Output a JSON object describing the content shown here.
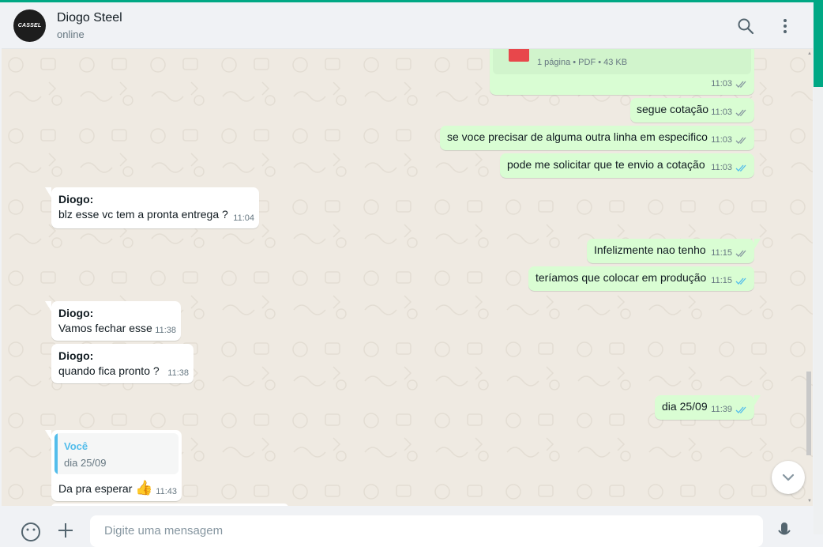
{
  "header": {
    "avatar_text": "CASSEL",
    "contact_name": "Diogo Steel",
    "status": "online"
  },
  "document": {
    "meta": "1 página • PDF • 43 KB",
    "time": "11:03"
  },
  "messages": [
    {
      "text": "segue cotação",
      "time": "11:03"
    },
    {
      "text": "se voce precisar de alguma outra linha em especifico",
      "time": "11:03"
    },
    {
      "text": "pode me solicitar que te envio a cotação",
      "time": "11:03"
    },
    {
      "sender": "Diogo:",
      "text": "blz esse vc tem a pronta entrega ?",
      "time": "11:04"
    },
    {
      "text": "Infelizmente nao tenho",
      "time": "11:15"
    },
    {
      "text": "teríamos que colocar em produção",
      "time": "11:15"
    },
    {
      "sender": "Diogo:",
      "text": "Vamos fechar esse",
      "time": "11:38"
    },
    {
      "sender": "Diogo:",
      "text": "quando fica pronto ?",
      "time": "11:38"
    },
    {
      "text": "dia 25/09",
      "time": "11:39"
    },
    {
      "quote_name": "Você",
      "quote_text": "dia 25/09",
      "text": "Da pra esperar",
      "emoji": "👍",
      "time": "11:43"
    }
  ],
  "composer": {
    "placeholder": "Digite uma mensagem"
  },
  "colors": {
    "accent": "#00a884",
    "outgoing_bubble": "#d9fdd3",
    "incoming_bubble": "#ffffff",
    "chat_background": "#efeae2",
    "read_ticks": "#53bdeb"
  },
  "icons": [
    "search-icon",
    "menu-icon",
    "double-check-icon",
    "chevron-down-icon",
    "emoji-icon",
    "attach-icon",
    "mic-icon"
  ]
}
